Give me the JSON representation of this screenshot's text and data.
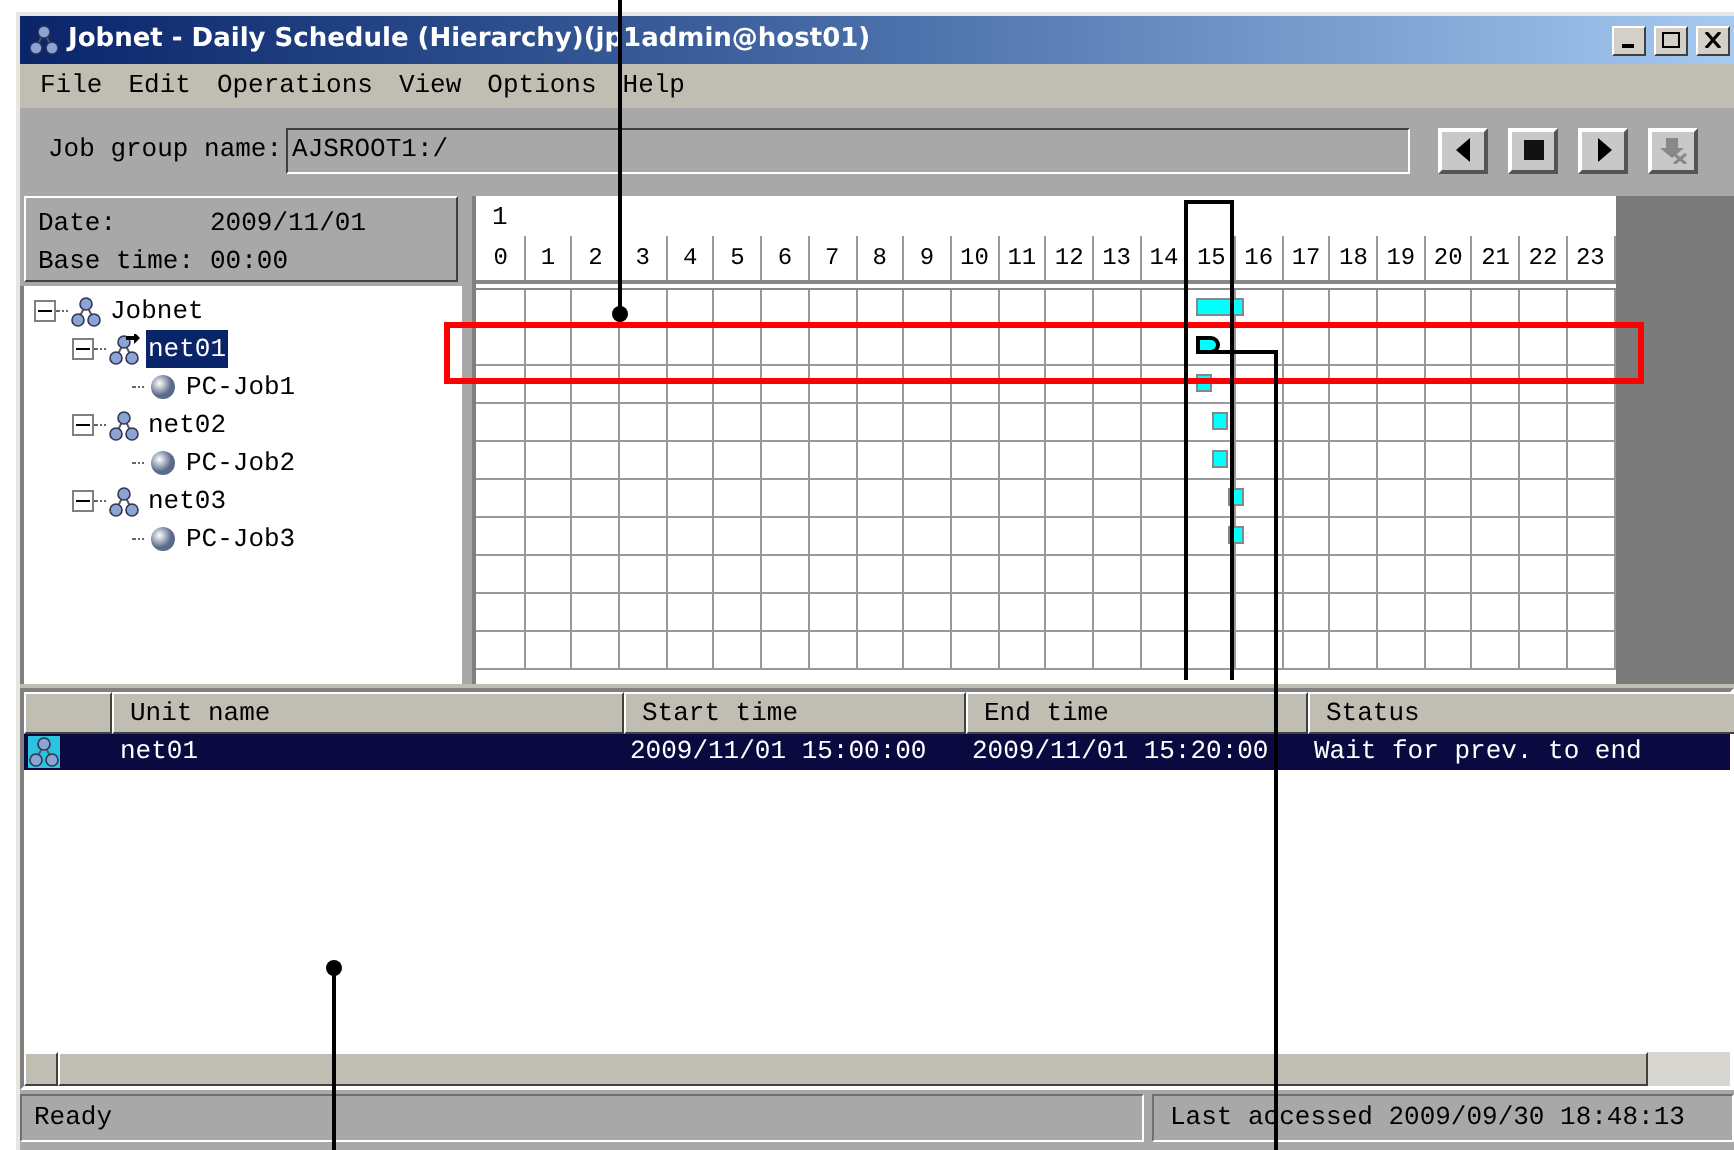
{
  "window": {
    "title": "Jobnet - Daily Schedule (Hierarchy)(jp1admin@host01)"
  },
  "menu": [
    "File",
    "Edit",
    "Operations",
    "View",
    "Options",
    "Help"
  ],
  "toolbar": {
    "label": "Job group name:",
    "value": "AJSROOT1:/"
  },
  "info": {
    "date_label": "Date:",
    "date": "2009/11/01",
    "base_label": "Base time:",
    "base": "00:00"
  },
  "tree": [
    {
      "label": "Jobnet",
      "kind": "jobnet",
      "expanded": true,
      "selected": false,
      "children": [
        {
          "label": "net01",
          "kind": "jobnet",
          "expanded": true,
          "selected": true,
          "children": [
            {
              "label": "PC-Job1",
              "kind": "job",
              "selected": false
            }
          ]
        },
        {
          "label": "net02",
          "kind": "jobnet",
          "expanded": true,
          "selected": false,
          "children": [
            {
              "label": "PC-Job2",
              "kind": "job",
              "selected": false
            }
          ]
        },
        {
          "label": "net03",
          "kind": "jobnet",
          "expanded": true,
          "selected": false,
          "children": [
            {
              "label": "PC-Job3",
              "kind": "job",
              "selected": false
            }
          ]
        }
      ]
    }
  ],
  "gantt": {
    "day": "1",
    "hours": [
      "0",
      "1",
      "2",
      "3",
      "4",
      "5",
      "6",
      "7",
      "8",
      "9",
      "10",
      "11",
      "12",
      "13",
      "14",
      "15",
      "16",
      "17",
      "18",
      "19",
      "20",
      "21",
      "22",
      "23"
    ]
  },
  "list": {
    "columns": [
      "Unit name",
      "Start time",
      "End time",
      "Status"
    ],
    "rows": [
      {
        "unit": "net01",
        "start": "2009/11/01 15:00:00",
        "end": "2009/11/01 15:20:00",
        "status": "Wait for prev. to end",
        "selected": true
      }
    ]
  },
  "status_bar": {
    "message": "Ready",
    "last_accessed": "Last accessed 2009/09/30 18:48:13"
  }
}
